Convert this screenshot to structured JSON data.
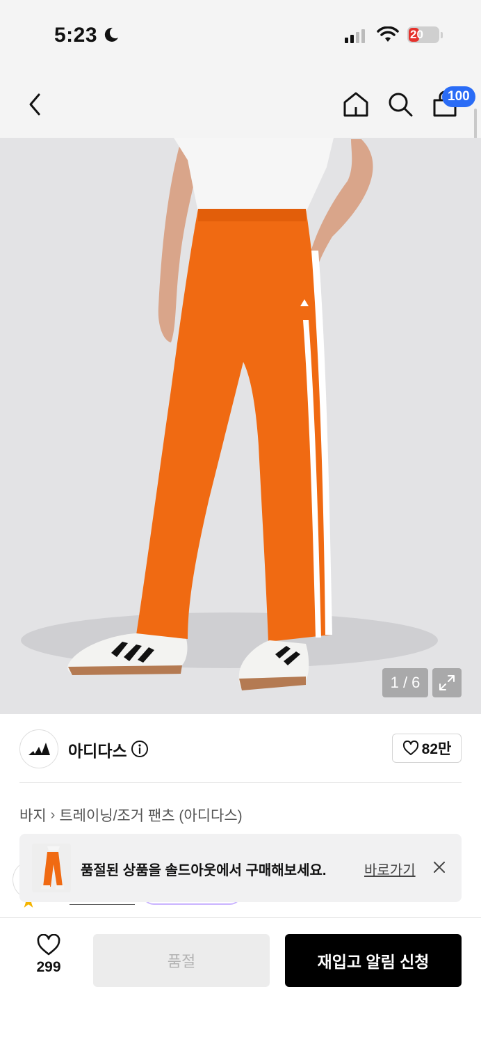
{
  "status_bar": {
    "time": "5:23",
    "battery_level": "20"
  },
  "header": {
    "cart_count": "100",
    "icons": [
      "back-chevron-icon",
      "home-icon",
      "search-icon",
      "shopping-bag-icon"
    ]
  },
  "gallery": {
    "counter": "1 / 6",
    "current_index": 1,
    "total": 6
  },
  "brand": {
    "name": "아디다스",
    "likes": "82만"
  },
  "breadcrumb": {
    "items": [
      "바지",
      "트레이닝/조거 팬츠 (아디다스)"
    ]
  },
  "banner": {
    "message": "품절된 상품을 솔드아웃에서 구매해보세요.",
    "link_label": "바로가기"
  },
  "bottom_bar": {
    "wish_count": "299",
    "soldout_label": "품절",
    "restock_label": "재입고 알림 신청"
  },
  "colors": {
    "badge": "#2a6cf6",
    "battery_low": "#e5322c",
    "primary_button": "#000000",
    "product": "#f06a12"
  }
}
